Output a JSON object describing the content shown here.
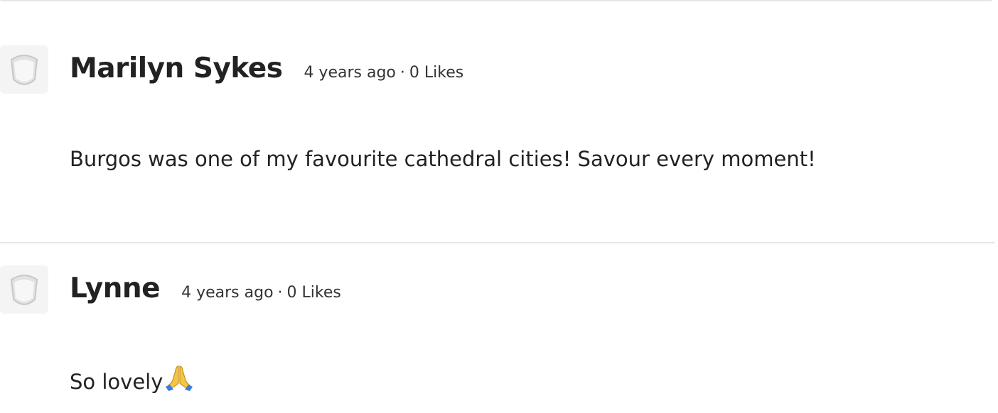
{
  "comments": [
    {
      "author": "Marilyn Sykes",
      "time": "4 years ago",
      "separator": "·",
      "likes": "0 Likes",
      "text": "Burgos was one of my favourite cathedral cities! Savour every moment!",
      "avatar_icon": "default-avatar-icon"
    },
    {
      "author": "Lynne",
      "time": "4 years ago",
      "separator": "·",
      "likes": "0 Likes",
      "text": "So lovely",
      "emoji_icon": "folded-hands-emoji-icon",
      "avatar_icon": "default-avatar-icon"
    }
  ],
  "colors": {
    "text": "#222222",
    "divider": "#e6e6e6",
    "avatar_bg": "#f4f4f4",
    "emoji_yellow": "#f2c744",
    "emoji_blue": "#3b7de0"
  }
}
